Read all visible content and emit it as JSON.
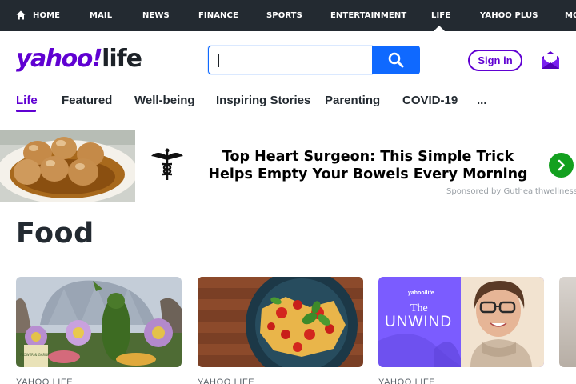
{
  "topnav": {
    "items": [
      {
        "label": "HOME"
      },
      {
        "label": "MAIL"
      },
      {
        "label": "NEWS"
      },
      {
        "label": "FINANCE"
      },
      {
        "label": "SPORTS"
      },
      {
        "label": "ENTERTAINMENT"
      },
      {
        "label": "LIFE"
      },
      {
        "label": "YAHOO PLUS"
      },
      {
        "label": "MO"
      }
    ]
  },
  "header": {
    "logo_primary": "yahoo!",
    "logo_secondary": "life",
    "search": {
      "value": "",
      "placeholder": ""
    },
    "signin_label": "Sign in"
  },
  "subnav": {
    "tabs": [
      {
        "label": "Life",
        "active": true
      },
      {
        "label": "Featured"
      },
      {
        "label": "Well-being"
      },
      {
        "label": "Inspiring Stories"
      },
      {
        "label": "Parenting"
      },
      {
        "label": "COVID-19"
      },
      {
        "label": "..."
      }
    ]
  },
  "ad": {
    "headline_line1": "Top Heart Surgeon: This Simple Trick",
    "headline_line2": "Helps Empty Your Bowels Every Morning",
    "sponsor": "Sponsored by Guthealthwellness"
  },
  "main": {
    "section_title": "Food",
    "cards": [
      {
        "source": "YAHOO LIFE",
        "image_sign": "FLOWER & GARDEN"
      },
      {
        "source": "YAHOO LIFE"
      },
      {
        "source": "YAHOO LIFE",
        "brand": "yahoo/life",
        "title_small": "The",
        "title_big": "UNWIND"
      }
    ]
  },
  "colors": {
    "brand_purple": "#6001d2",
    "topnav_bg": "#232a31",
    "search_blue": "#0f69ff",
    "ad_green": "#13a01f",
    "unwind_bg": "#7b5cff"
  },
  "icons": [
    "home-icon",
    "search-icon",
    "mail-icon",
    "caduceus-icon",
    "arrow-right-icon"
  ]
}
